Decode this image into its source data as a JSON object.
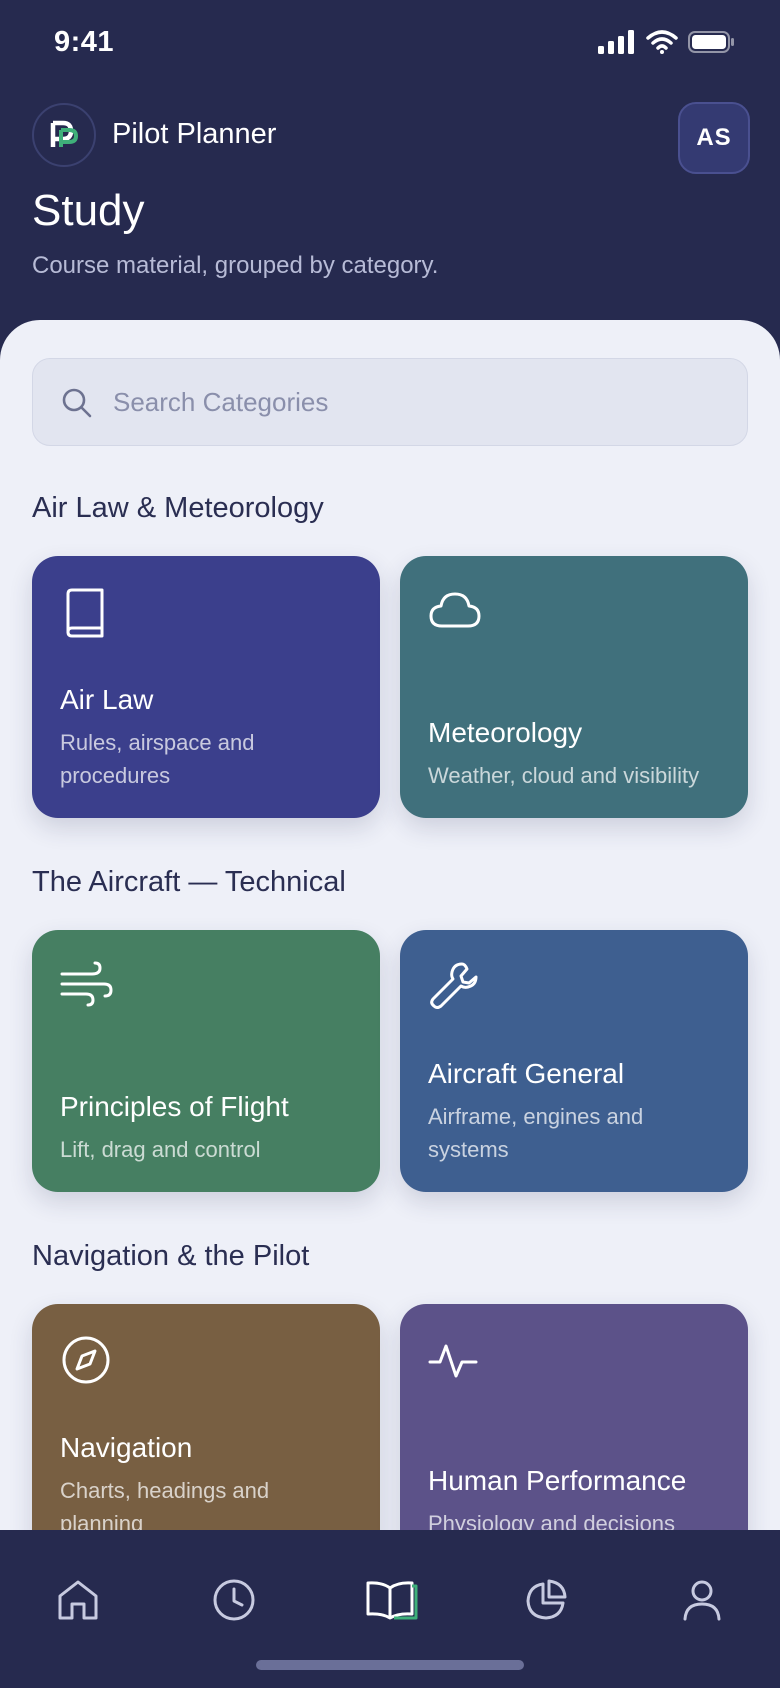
{
  "status_bar": {
    "time": "9:41",
    "icons": [
      "signal-icon",
      "wifi-icon",
      "battery-icon"
    ]
  },
  "header": {
    "logo_text": "P",
    "app_name": "Pilot Planner",
    "avatar_initials": "AS",
    "title": "Study",
    "subtitle": "Course material, grouped by category."
  },
  "search": {
    "placeholder": "Search Categories",
    "value": ""
  },
  "sections": [
    {
      "title": "Air Law & Meteorology",
      "cards": [
        {
          "title": "Air Law",
          "description": "Rules, airspace and procedures",
          "icon": "book-icon",
          "color": "#3b3f8c"
        },
        {
          "title": "Meteorology",
          "description": "Weather, cloud and visibility",
          "icon": "cloud-icon",
          "color": "#40707c"
        }
      ]
    },
    {
      "title": "The Aircraft — Technical",
      "cards": [
        {
          "title": "Principles of Flight",
          "description": "Lift, drag and control",
          "icon": "wind-icon",
          "color": "#467f62"
        },
        {
          "title": "Aircraft General",
          "description": "Airframe, engines and systems",
          "icon": "wrench-icon",
          "color": "#3e5f90"
        }
      ]
    },
    {
      "title": "Navigation & the Pilot",
      "cards": [
        {
          "title": "Navigation",
          "description": "Charts, headings and planning",
          "icon": "compass-icon",
          "color": "#785f42"
        },
        {
          "title": "Human Performance",
          "description": "Physiology and decisions",
          "icon": "activity-icon",
          "color": "#5c5289"
        }
      ]
    }
  ],
  "tab_bar": {
    "tabs": [
      {
        "name": "home",
        "icon": "home-icon",
        "active": false
      },
      {
        "name": "history",
        "icon": "clock-icon",
        "active": false
      },
      {
        "name": "study",
        "icon": "open-book-icon",
        "active": true
      },
      {
        "name": "stats",
        "icon": "pie-chart-icon",
        "active": false
      },
      {
        "name": "profile",
        "icon": "user-icon",
        "active": false
      }
    ]
  },
  "colors": {
    "header_bg": "#262a4f",
    "sheet_bg": "#eef0f8",
    "active_accent": "#3fb07a"
  }
}
